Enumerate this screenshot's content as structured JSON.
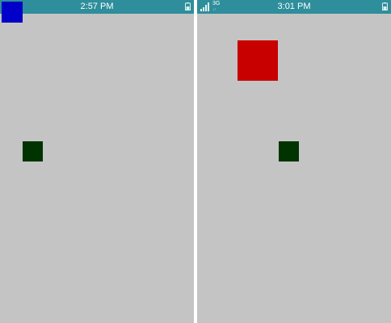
{
  "screens": [
    {
      "status_time": "2:57 PM",
      "battery_icon": "battery-icon",
      "shapes": [
        {
          "name": "blue-square",
          "color": "#0000c8"
        },
        {
          "name": "dark-green-square",
          "color": "#003300"
        }
      ]
    },
    {
      "status_time": "3:01 PM",
      "network": "3G",
      "network_sub": "↓↑",
      "signal_icon": "signal-bars-icon",
      "battery_icon": "battery-icon",
      "shapes": [
        {
          "name": "red-square",
          "color": "#c80000"
        },
        {
          "name": "dark-green-square",
          "color": "#003300"
        }
      ]
    }
  ],
  "colors": {
    "status_bar": "#2e8e9b",
    "screen_background": "#c4c4c4",
    "divider": "#ffffff"
  }
}
